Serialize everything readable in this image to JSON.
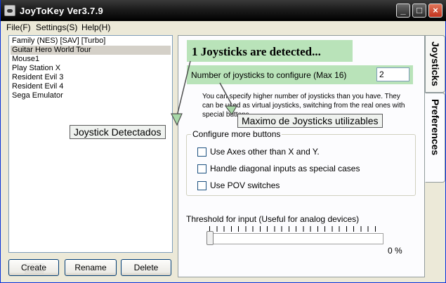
{
  "window": {
    "title": "JoyToKey Ver3.7.9",
    "minimize_glyph": "_",
    "maximize_glyph": "□",
    "close_glyph": "×"
  },
  "menu": {
    "items": [
      "File(F)",
      "Settings(S)",
      "Help(H)"
    ]
  },
  "profiles": {
    "items": [
      "Family (NES) [SAV] [Turbo]",
      "Guitar Hero World Tour",
      "Mouse1",
      "Play Station X",
      "Resident Evil 3",
      "Resident Evil 4",
      "Sega Emulator"
    ],
    "selected_index": 1
  },
  "buttons": {
    "create": "Create",
    "rename": "Rename",
    "delete": "Delete"
  },
  "tabs": {
    "joysticks": "Joysticks",
    "preferences": "Preferences",
    "active": "preferences"
  },
  "preferences": {
    "detected_text": "1 Joysticks are detected...",
    "config_label": "Number of joysticks to configure (Max 16)",
    "config_value": "2",
    "help_text": "You can specify higher number of joysticks than you have. They can be used as virtual joysticks, switching from the real ones with special buttons.",
    "group_title": "Configure more buttons",
    "options": [
      {
        "label": "Use Axes other than X and Y.",
        "checked": false
      },
      {
        "label": "Handle diagonal inputs as special cases",
        "checked": false
      },
      {
        "label": "Use POV switches",
        "checked": false
      }
    ],
    "threshold_label": "Threshold for input (Useful for analog devices)",
    "threshold_value": 0,
    "threshold_text": "0 %"
  },
  "annotations": {
    "detected": "Joystick Detectados",
    "max": "Maximo de Joysticks utilizables"
  },
  "colors": {
    "highlight": "#b9e3b9",
    "selection": "#d4d0c8",
    "panel": "#fcfcfe",
    "window": "#ece9d8"
  }
}
